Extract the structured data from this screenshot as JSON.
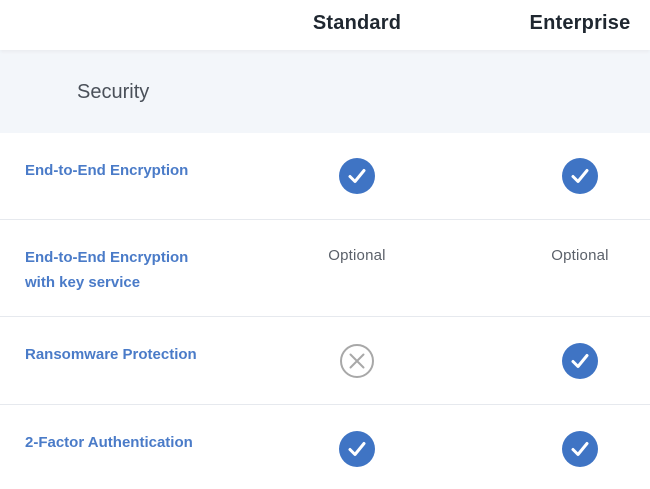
{
  "plans": {
    "standard": "Standard",
    "enterprise": "Enterprise"
  },
  "section": {
    "title": "Security"
  },
  "features": [
    {
      "label": "End-to-End Encryption",
      "standard": "included",
      "enterprise": "included"
    },
    {
      "label_line1": "End-to-End Encryption",
      "label_line2": "with key service",
      "standard": "Optional",
      "enterprise": "Optional"
    },
    {
      "label": "Ransomware Protection",
      "standard": "not-included",
      "enterprise": "included"
    },
    {
      "label": "2-Factor Authentication",
      "standard": "included",
      "enterprise": "included"
    }
  ],
  "icons": {
    "included": "check-circle-icon",
    "not_included": "x-circle-icon"
  },
  "colors": {
    "check_fill": "#3f74c4",
    "feature_label": "#4a7bc8",
    "section_band": "#f3f6fa",
    "cross_stroke": "#a8a8a8"
  }
}
